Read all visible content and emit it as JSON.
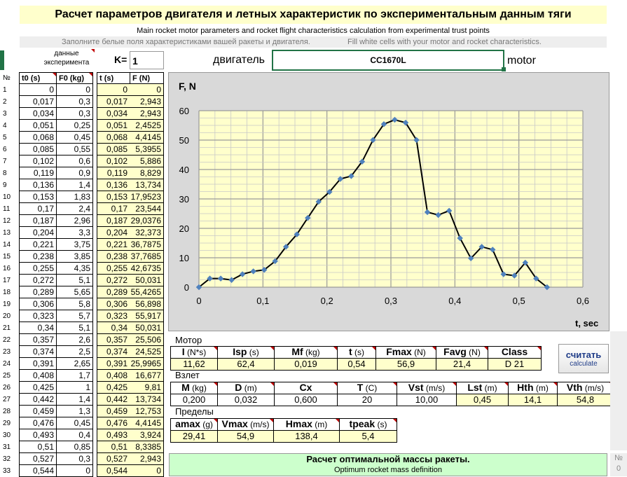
{
  "header": {
    "title": "Расчет параметров двигателя и летных характеристик по экспериментальным данным тяги",
    "subtitle": "Main rocket motor parameters and rocket flight characteristics calculation from experimental trust points",
    "hint_ru": "Заполните белые поля характеристиками вашей ракеты и двигателя.",
    "hint_en": "Fill white cells with your motor and rocket characteristics."
  },
  "top": {
    "exp_data_label_1": "данные",
    "exp_data_label_2": "эксперимента",
    "k_label": "K=",
    "k_value": "1",
    "engine_label": "двигатель",
    "engine_value": "CC1670L",
    "motor_label": "motor"
  },
  "table": {
    "col_num": "№",
    "col_t0": "t0 (s)",
    "col_f0": "F0 (kg)",
    "col_t": "t (s)",
    "col_f": "F (N)",
    "rows": [
      [
        "1",
        "0",
        "0",
        "0",
        "0"
      ],
      [
        "2",
        "0,017",
        "0,3",
        "0,017",
        "2,943"
      ],
      [
        "3",
        "0,034",
        "0,3",
        "0,034",
        "2,943"
      ],
      [
        "4",
        "0,051",
        "0,25",
        "0,051",
        "2,4525"
      ],
      [
        "5",
        "0,068",
        "0,45",
        "0,068",
        "4,4145"
      ],
      [
        "6",
        "0,085",
        "0,55",
        "0,085",
        "5,3955"
      ],
      [
        "7",
        "0,102",
        "0,6",
        "0,102",
        "5,886"
      ],
      [
        "8",
        "0,119",
        "0,9",
        "0,119",
        "8,829"
      ],
      [
        "9",
        "0,136",
        "1,4",
        "0,136",
        "13,734"
      ],
      [
        "10",
        "0,153",
        "1,83",
        "0,153",
        "17,9523"
      ],
      [
        "11",
        "0,17",
        "2,4",
        "0,17",
        "23,544"
      ],
      [
        "12",
        "0,187",
        "2,96",
        "0,187",
        "29,0376"
      ],
      [
        "13",
        "0,204",
        "3,3",
        "0,204",
        "32,373"
      ],
      [
        "14",
        "0,221",
        "3,75",
        "0,221",
        "36,7875"
      ],
      [
        "15",
        "0,238",
        "3,85",
        "0,238",
        "37,7685"
      ],
      [
        "16",
        "0,255",
        "4,35",
        "0,255",
        "42,6735"
      ],
      [
        "17",
        "0,272",
        "5,1",
        "0,272",
        "50,031"
      ],
      [
        "18",
        "0,289",
        "5,65",
        "0,289",
        "55,4265"
      ],
      [
        "19",
        "0,306",
        "5,8",
        "0,306",
        "56,898"
      ],
      [
        "20",
        "0,323",
        "5,7",
        "0,323",
        "55,917"
      ],
      [
        "21",
        "0,34",
        "5,1",
        "0,34",
        "50,031"
      ],
      [
        "22",
        "0,357",
        "2,6",
        "0,357",
        "25,506"
      ],
      [
        "23",
        "0,374",
        "2,5",
        "0,374",
        "24,525"
      ],
      [
        "24",
        "0,391",
        "2,65",
        "0,391",
        "25,9965"
      ],
      [
        "25",
        "0,408",
        "1,7",
        "0,408",
        "16,677"
      ],
      [
        "26",
        "0,425",
        "1",
        "0,425",
        "9,81"
      ],
      [
        "27",
        "0,442",
        "1,4",
        "0,442",
        "13,734"
      ],
      [
        "28",
        "0,459",
        "1,3",
        "0,459",
        "12,753"
      ],
      [
        "29",
        "0,476",
        "0,45",
        "0,476",
        "4,4145"
      ],
      [
        "30",
        "0,493",
        "0,4",
        "0,493",
        "3,924"
      ],
      [
        "31",
        "0,51",
        "0,85",
        "0,51",
        "8,3385"
      ],
      [
        "32",
        "0,527",
        "0,3",
        "0,527",
        "2,943"
      ],
      [
        "33",
        "0,544",
        "0",
        "0,544",
        "0"
      ]
    ]
  },
  "chart_data": {
    "type": "line",
    "ylabel": "F, N",
    "xlabel": "t, sec",
    "xlim": [
      0,
      0.6
    ],
    "ylim": [
      0,
      60
    ],
    "x_ticks": [
      "0",
      "0,1",
      "0,2",
      "0,3",
      "0,4",
      "0,5",
      "0,6"
    ],
    "y_ticks": [
      "0",
      "10",
      "20",
      "30",
      "40",
      "50",
      "60"
    ],
    "grid": true,
    "x": [
      0,
      0.017,
      0.034,
      0.051,
      0.068,
      0.085,
      0.102,
      0.119,
      0.136,
      0.153,
      0.17,
      0.187,
      0.204,
      0.221,
      0.238,
      0.255,
      0.272,
      0.289,
      0.306,
      0.323,
      0.34,
      0.357,
      0.374,
      0.391,
      0.408,
      0.425,
      0.442,
      0.459,
      0.476,
      0.493,
      0.51,
      0.527,
      0.544
    ],
    "y": [
      0,
      2.943,
      2.943,
      2.4525,
      4.4145,
      5.3955,
      5.886,
      8.829,
      13.734,
      17.9523,
      23.544,
      29.0376,
      32.373,
      36.7875,
      37.7685,
      42.6735,
      50.031,
      55.4265,
      56.898,
      55.917,
      50.031,
      25.506,
      24.525,
      25.9965,
      16.677,
      9.81,
      13.734,
      12.753,
      4.4145,
      3.924,
      8.3385,
      2.943,
      0
    ],
    "colors": {
      "line": "#000000",
      "marker": "#4f81bd",
      "plot_bg": "#ffffcc",
      "panel_bg": "#d9d9d9"
    }
  },
  "motor": {
    "section": "Мотор",
    "headers": [
      {
        "sym": "I",
        "unit": " (N*s)"
      },
      {
        "sym": "Isp",
        "unit": " (s)"
      },
      {
        "sym": "Mf",
        "unit": " (kg)"
      },
      {
        "sym": "t",
        "unit": " (s)"
      },
      {
        "sym": "Fmax",
        "unit": " (N)"
      },
      {
        "sym": "Favg",
        "unit": " (N)"
      },
      {
        "sym": "Class",
        "unit": ""
      }
    ],
    "values": [
      "11,62",
      "62,4",
      "0,019",
      "0,54",
      "56,9",
      "21,4",
      "D 21"
    ]
  },
  "calc_button": {
    "label_ru": "считать",
    "label_en": "calculate"
  },
  "launch": {
    "section": "Взлет",
    "headers": [
      {
        "sym": "M",
        "unit": " (kg)"
      },
      {
        "sym": "D",
        "unit": " (m)"
      },
      {
        "sym": "Cx",
        "unit": ""
      },
      {
        "sym": "T",
        "unit": " (C)"
      },
      {
        "sym": "Vst",
        "unit": " (m/s)"
      },
      {
        "sym": "Lst",
        "unit": " (m)"
      },
      {
        "sym": "Hth",
        "unit": " (m)"
      },
      {
        "sym": "Vth",
        "unit": " (m/s)"
      }
    ],
    "values": [
      "0,200",
      "0,032",
      "0,600",
      "20",
      "10,00",
      "0,45",
      "14,1",
      "54,8"
    ]
  },
  "limits": {
    "section": "Пределы",
    "headers": [
      {
        "sym": "amax",
        "unit": " (g)"
      },
      {
        "sym": "Vmax",
        "unit": " (m/s)"
      },
      {
        "sym": "Hmax",
        "unit": " (m)"
      },
      {
        "sym": "tpeak",
        "unit": " (s)"
      }
    ],
    "values": [
      "29,41",
      "54,9",
      "138,4",
      "5,4"
    ]
  },
  "optimum": {
    "title": "Расчет оптимальной массы ракеты.",
    "subtitle": "Optimum rocket mass definition",
    "corner_label": "№",
    "corner_value": "0"
  }
}
